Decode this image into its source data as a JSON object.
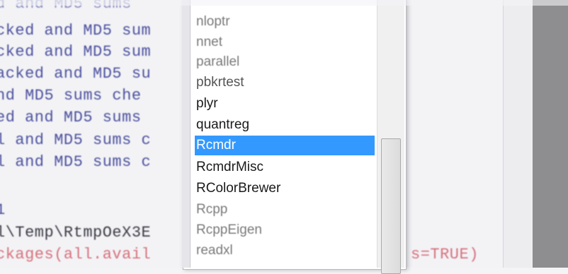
{
  "console": {
    "lines": [
      "d and MD5 sums",
      "cked and MD5 sum",
      "cked and MD5 sum",
      "acked and MD5 su",
      "nd MD5 sums che",
      "ed and MD5 sums",
      "l and MD5 sums c",
      "l and MD5 sums c",
      "1",
      "l\\Temp\\RtmpOeX3E",
      "ckages(all.avail",
      "s=TRUE)"
    ]
  },
  "package_list": {
    "items": [
      {
        "label": "nloptr"
      },
      {
        "label": "nnet"
      },
      {
        "label": "parallel"
      },
      {
        "label": "pbkrtest"
      },
      {
        "label": "plyr"
      },
      {
        "label": "quantreg"
      },
      {
        "label": "Rcmdr"
      },
      {
        "label": "RcmdrMisc"
      },
      {
        "label": "RColorBrewer"
      },
      {
        "label": "Rcpp"
      },
      {
        "label": "RcppEigen"
      },
      {
        "label": "readxl"
      }
    ],
    "selected": "Rcmdr"
  },
  "colors": {
    "selection": "#3399ff",
    "console_text": "#4a4f9c",
    "console_red": "#d6707a"
  }
}
